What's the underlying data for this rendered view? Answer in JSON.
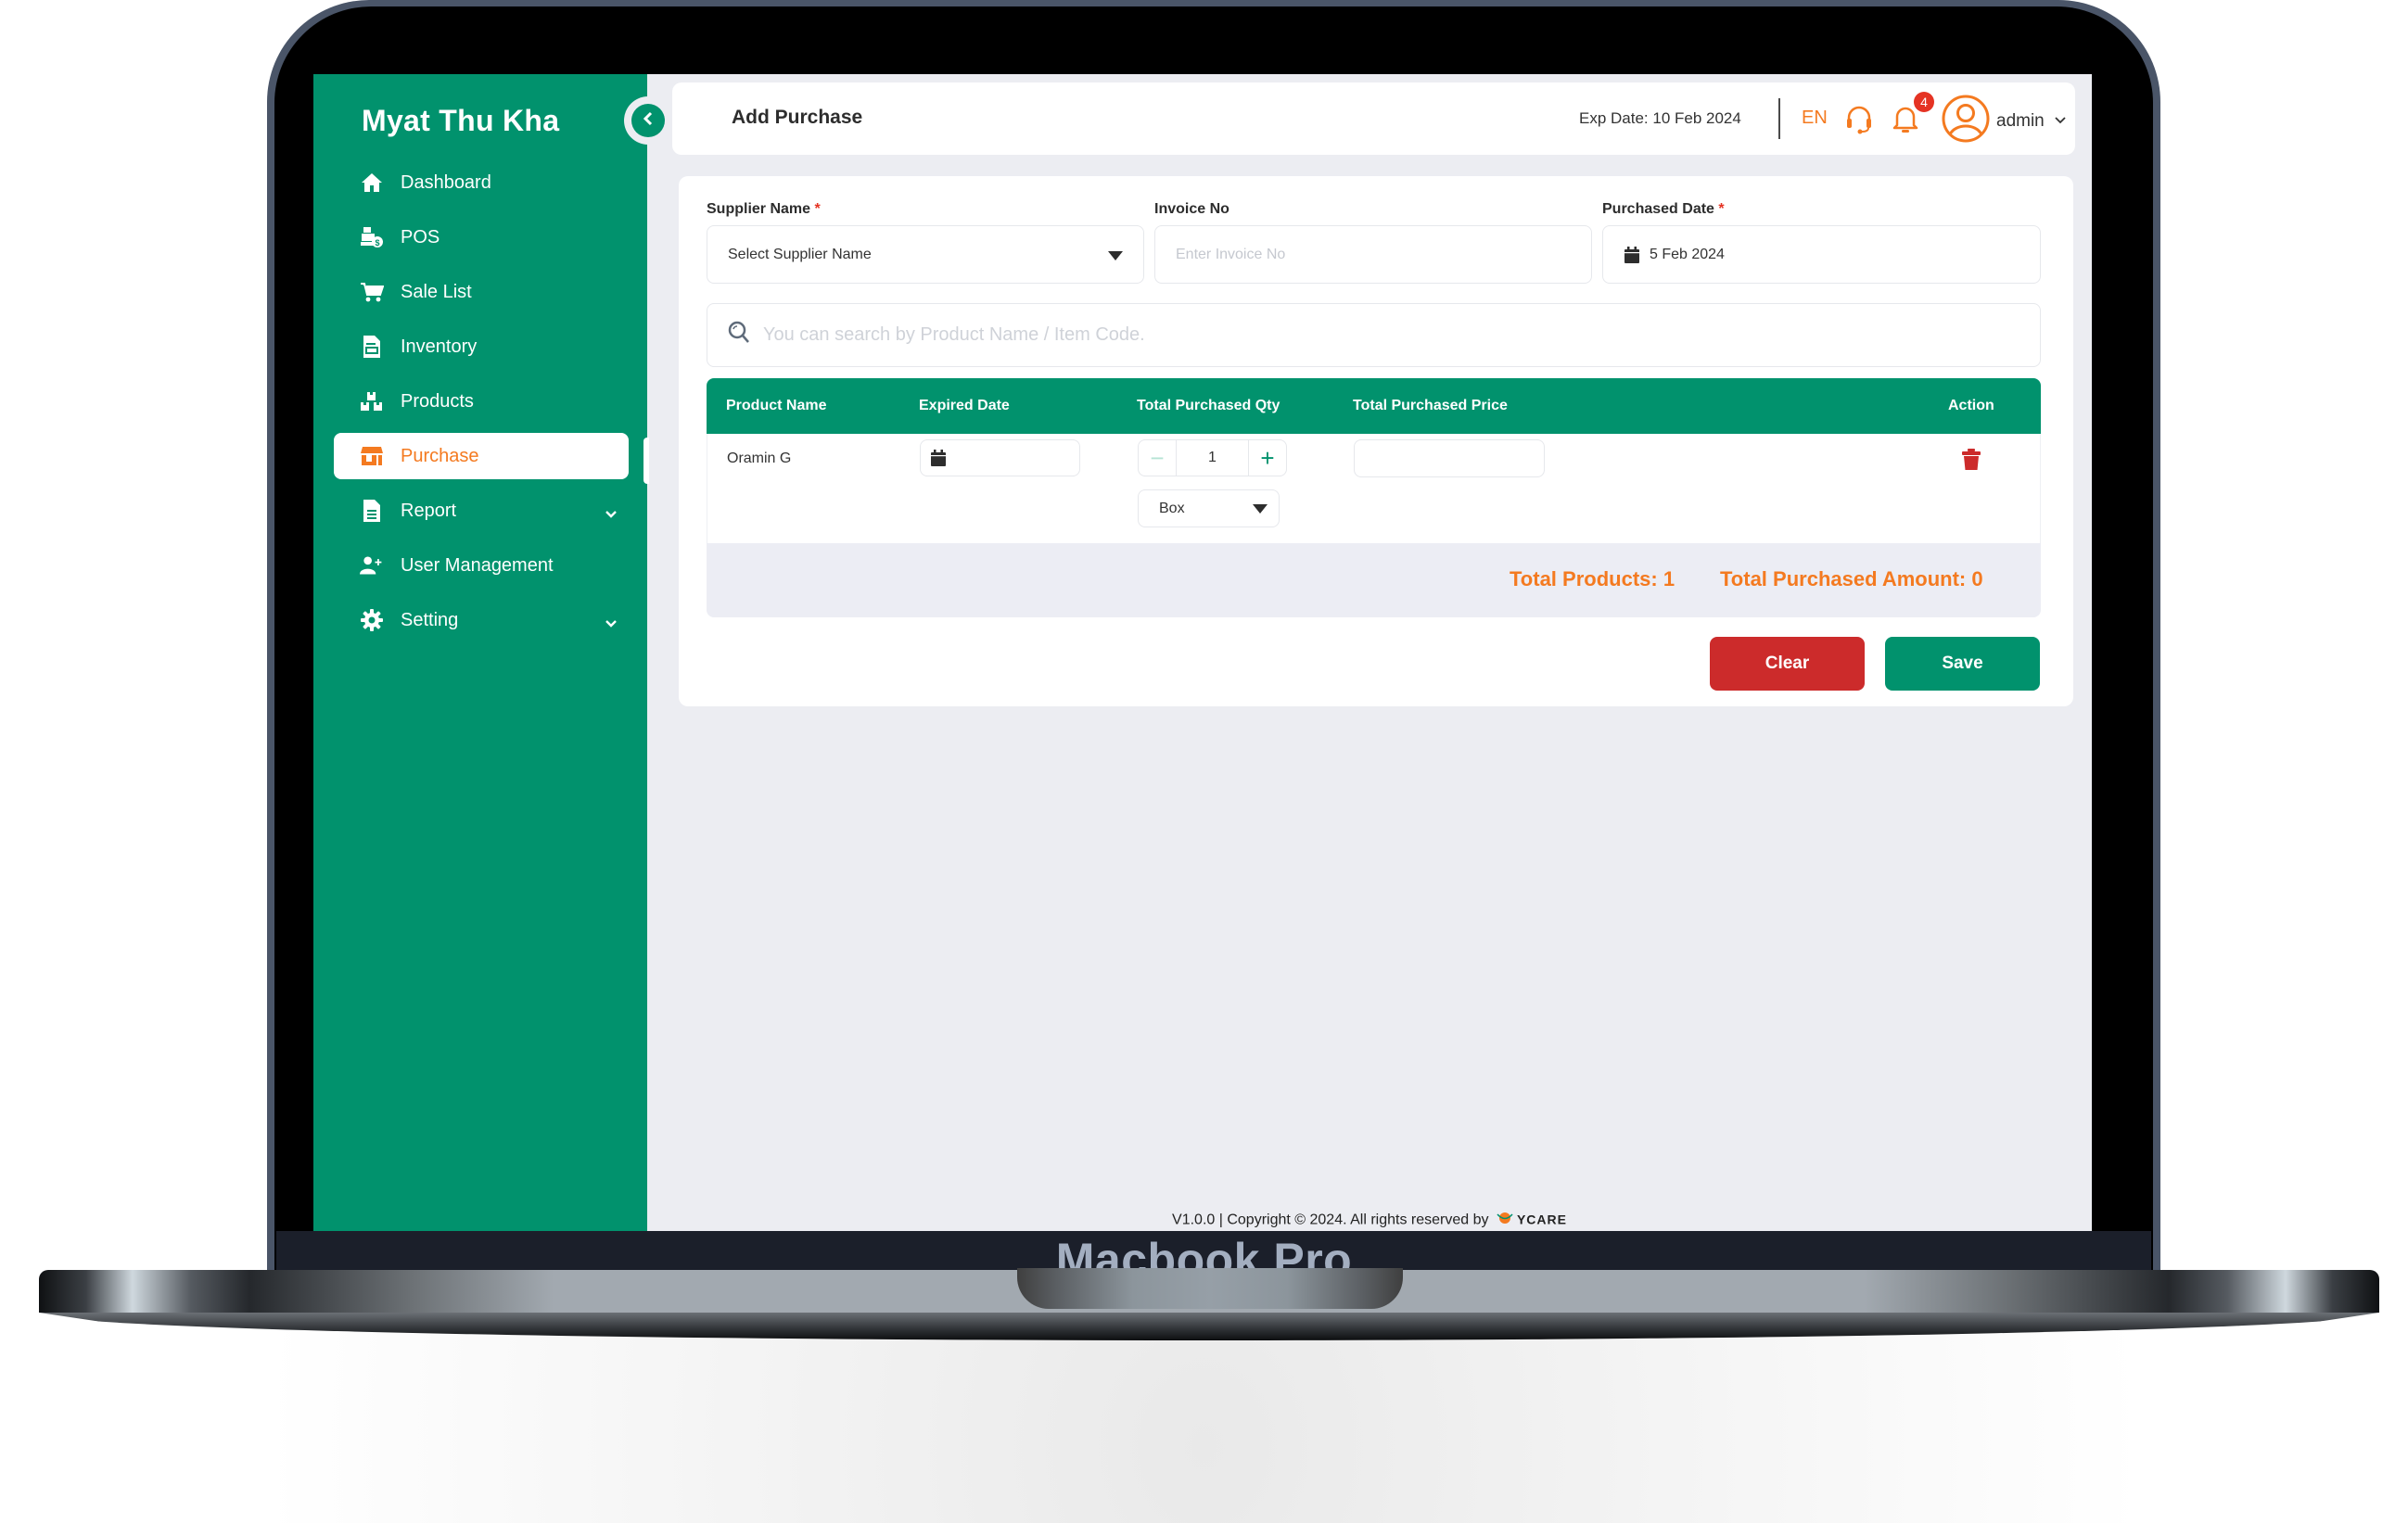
{
  "device": {
    "label": "Macbook Pro"
  },
  "sidebar": {
    "brand": "Myat Thu Kha",
    "items": [
      {
        "label": "Dashboard",
        "icon": "home-icon",
        "active": false
      },
      {
        "label": "POS",
        "icon": "cash-register-icon",
        "active": false
      },
      {
        "label": "Sale List",
        "icon": "cart-icon",
        "active": false
      },
      {
        "label": "Inventory",
        "icon": "inventory-document-icon",
        "active": false
      },
      {
        "label": "Products",
        "icon": "boxes-icon",
        "active": false
      },
      {
        "label": "Purchase",
        "icon": "store-icon",
        "active": true
      },
      {
        "label": "Report",
        "icon": "report-file-icon",
        "active": false,
        "expandable": true
      },
      {
        "label": "User Management",
        "icon": "user-plus-icon",
        "active": false
      },
      {
        "label": "Setting",
        "icon": "gear-icon",
        "active": false,
        "expandable": true
      }
    ]
  },
  "header": {
    "title": "Add Purchase",
    "exp_date": "Exp Date: 10 Feb 2024",
    "language": "EN",
    "notification_count": "4",
    "user": "admin"
  },
  "form": {
    "supplier": {
      "label": "Supplier Name",
      "required": "*",
      "value": "Select Supplier Name"
    },
    "invoice": {
      "label": "Invoice No",
      "placeholder": "Enter Invoice No",
      "value": ""
    },
    "purchased_date": {
      "label": "Purchased Date",
      "required": "*",
      "value": "5 Feb 2024"
    },
    "search_placeholder": "You can search by Product Name / Item Code."
  },
  "table": {
    "columns": [
      "Product Name",
      "Expired Date",
      "Total Purchased Qty",
      "Total Purchased Price",
      "Action"
    ],
    "rows": [
      {
        "product_name": "Oramin G",
        "expired_date": "",
        "qty": "1",
        "unit": "Box",
        "price": ""
      }
    ]
  },
  "summary": {
    "total_products": "Total Products: 1",
    "total_amount": "Total Purchased Amount: 0"
  },
  "actions": {
    "clear": "Clear",
    "save": "Save"
  },
  "footer": {
    "text": "V1.0.0 | Copyright © 2024. All rights reserved by",
    "brand": "YCARE"
  },
  "colors": {
    "primary": "#01926d",
    "accent": "#f47a20",
    "danger": "#cc2b2b",
    "badge": "#e53323",
    "background": "#ecedf2"
  }
}
